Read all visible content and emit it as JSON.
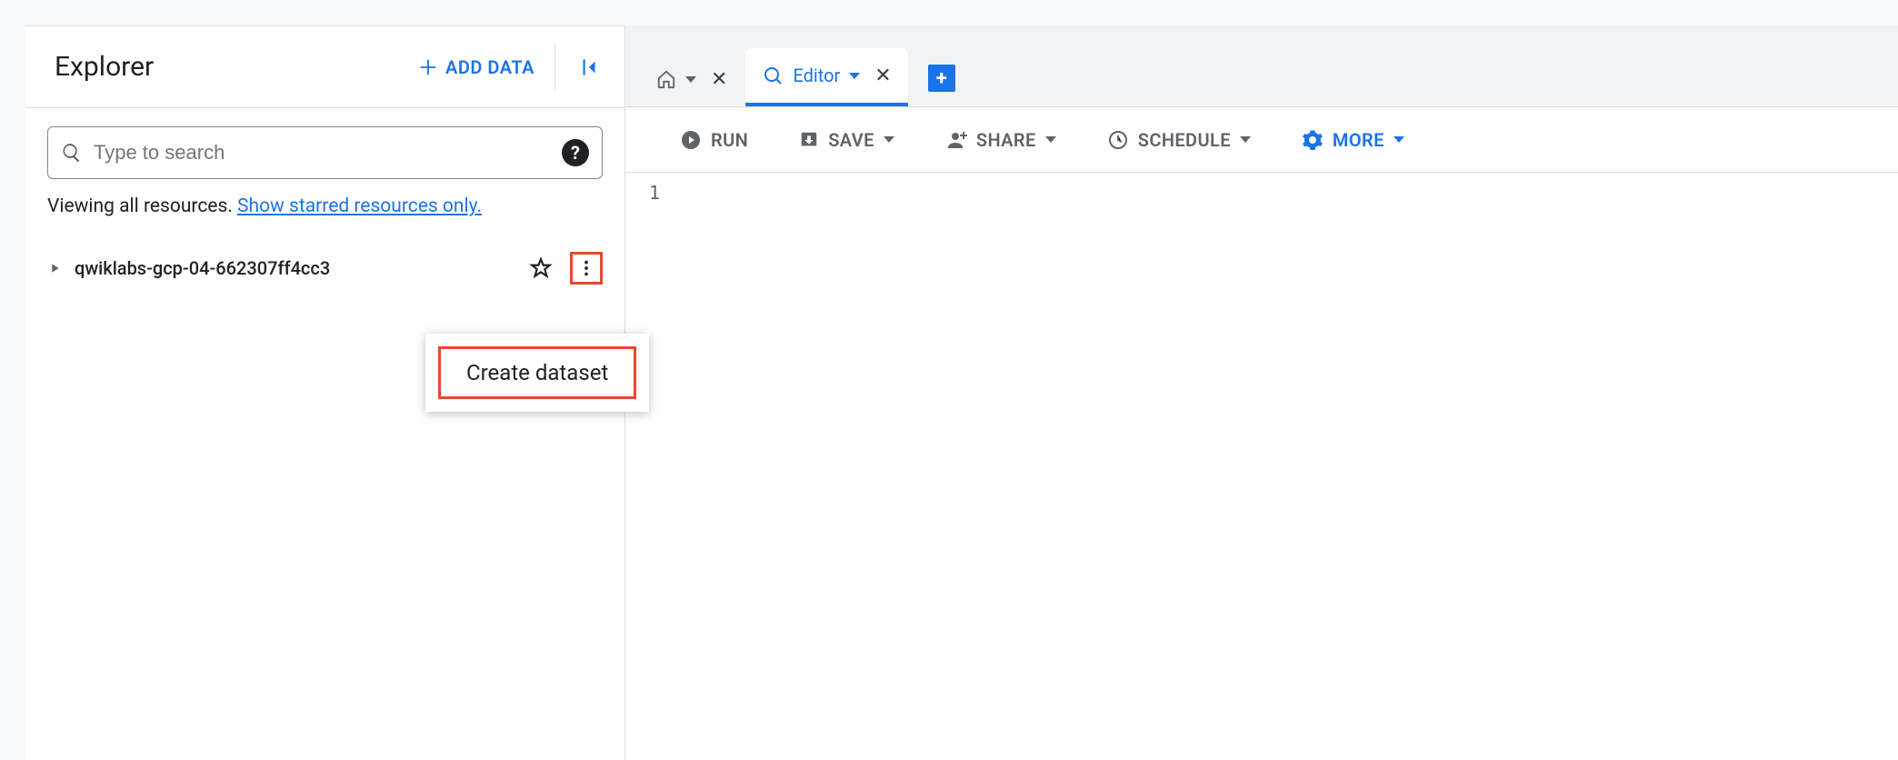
{
  "explorer": {
    "title": "Explorer",
    "add_data_label": "ADD DATA",
    "search_placeholder": "Type to search",
    "viewing_prefix": "Viewing all resources. ",
    "viewing_link": "Show starred resources only.",
    "project_name": "qwiklabs-gcp-04-662307ff4cc3",
    "context_menu_item": "Create dataset"
  },
  "tabs": {
    "editor_label": "Editor"
  },
  "toolbar": {
    "run": "RUN",
    "save": "SAVE",
    "share": "SHARE",
    "schedule": "SCHEDULE",
    "more": "MORE"
  },
  "editor": {
    "line1": "1"
  }
}
